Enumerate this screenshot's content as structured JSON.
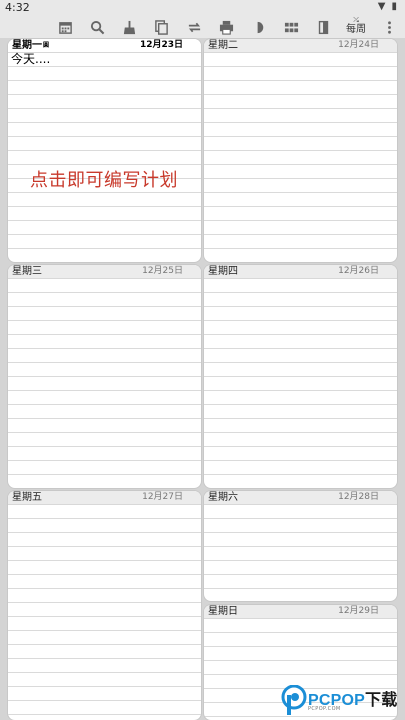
{
  "status_bar": {
    "time": "4:32"
  },
  "toolbar": {
    "icons": [
      "calendar-icon",
      "search-icon",
      "broom-icon",
      "copy-icon",
      "swap-icon",
      "print-icon",
      "half-moon-icon",
      "grid-icon",
      "book-icon",
      "more-vertical-icon"
    ],
    "weekly_label": "每周"
  },
  "days": [
    {
      "name": "星期一",
      "date": "12月23日",
      "today_mark": "圓",
      "note": "今天....",
      "hint": "点击即可编写计划"
    },
    {
      "name": "星期二",
      "date": "12月24日"
    },
    {
      "name": "星期三",
      "date": "12月25日"
    },
    {
      "name": "星期四",
      "date": "12月26日"
    },
    {
      "name": "星期五",
      "date": "12月27日"
    },
    {
      "name": "星期六",
      "date": "12月28日"
    },
    {
      "name": "星期日",
      "date": "12月29日"
    }
  ],
  "watermark": {
    "brand": "PCPOP",
    "suffix": "下载",
    "sub": "PCPOP.COM"
  },
  "colors": {
    "hint": "#c8392b",
    "brand": "#1b8ed6",
    "background": "#d4d4d4"
  }
}
